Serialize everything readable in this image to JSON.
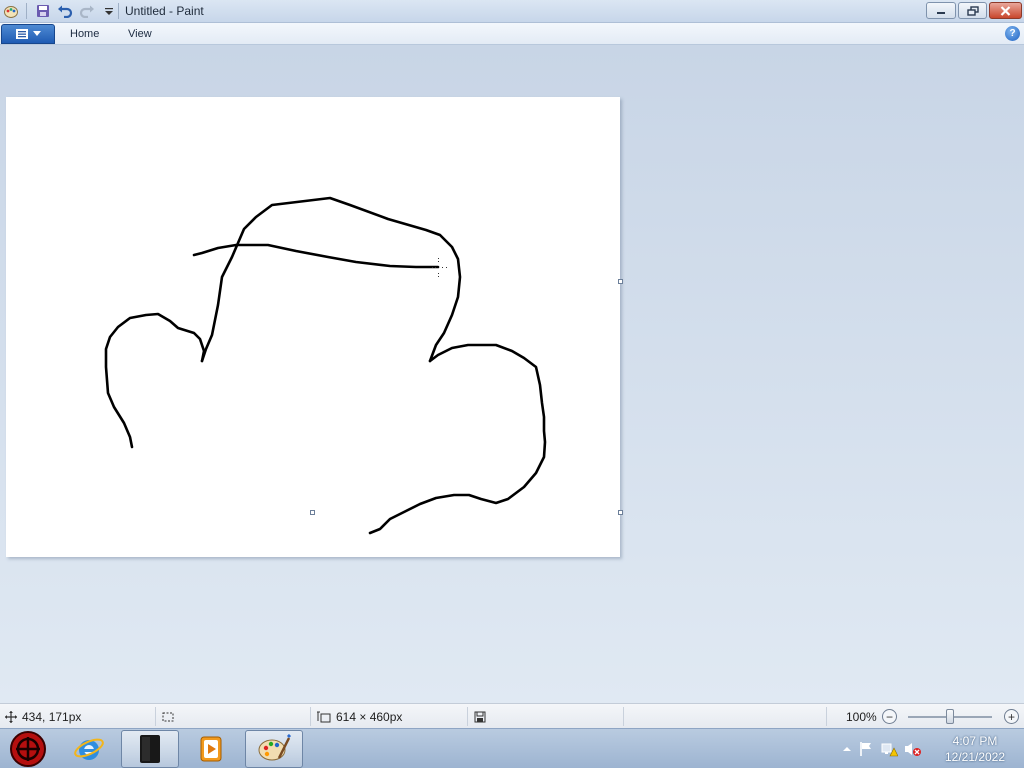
{
  "window": {
    "title": "Untitled - Paint"
  },
  "ribbon": {
    "tabs": [
      {
        "label": "Home"
      },
      {
        "label": "View"
      }
    ],
    "help_label": "?"
  },
  "status_bar": {
    "cursor_position": "434, 171px",
    "image_size": "614 × 460px",
    "zoom": "100%",
    "zoom_level": 1.0
  },
  "taskbar": {
    "items": [
      {
        "icon": "red-circle-app-icon"
      },
      {
        "icon": "internet-explorer-icon"
      },
      {
        "icon": "dark-device-app-icon"
      },
      {
        "icon": "media-player-icon"
      },
      {
        "icon": "paint-palette-icon",
        "active": true
      }
    ],
    "clock_time": "4:07 PM",
    "clock_date": "12/21/2022"
  },
  "colors": {
    "canvas": "#ffffff",
    "stroke": "#000000",
    "close_button": "#c9462c",
    "file_button": "#1f5bb3"
  }
}
